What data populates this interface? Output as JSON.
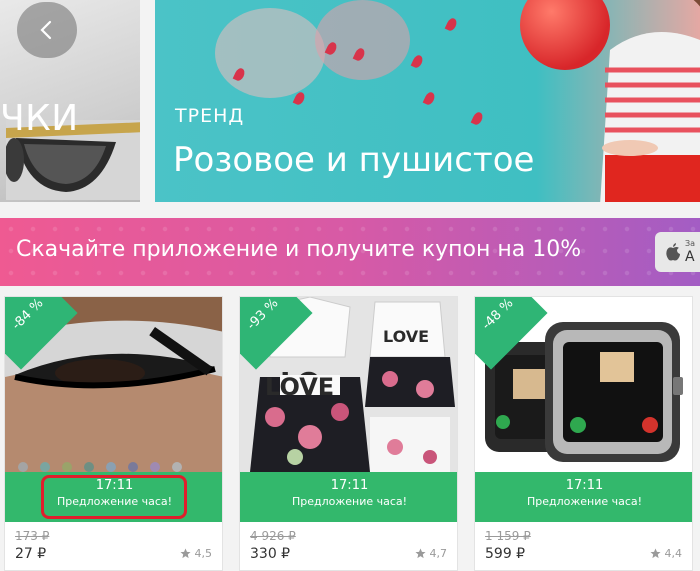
{
  "banners": {
    "left_label": "ЧКИ",
    "trend_small": "ТРЕНД",
    "trend_title": "Розовое и пушистое"
  },
  "promo": {
    "text": "Скачайте приложение и получите купон на 10%",
    "store_small": "За",
    "store_big": "A"
  },
  "icons": {
    "back": "chevron-left-icon",
    "star": "star-icon",
    "apple": "apple-icon"
  },
  "colors": {
    "deal_green": "#33b86c",
    "badge_green": "#2fb575",
    "highlight_red": "#e01e2c",
    "promo_pink": "#ef5a92",
    "promo_purple": "#a35dc4",
    "banner_teal": "#4bc3c7"
  },
  "products": [
    {
      "discount": "-84 %",
      "time": "17:11",
      "deal_label": "Предложение часа!",
      "old_price": "173 ₽",
      "price": "27 ₽",
      "rating": "4,5",
      "highlighted": true
    },
    {
      "discount": "-93 %",
      "time": "17:11",
      "deal_label": "Предложение часа!",
      "old_price": "4 926 ₽",
      "price": "330 ₽",
      "rating": "4,7",
      "highlighted": false
    },
    {
      "discount": "-48 %",
      "time": "17:11",
      "deal_label": "Предложение часа!",
      "old_price": "1 159 ₽",
      "price": "599 ₽",
      "rating": "4,4",
      "highlighted": false
    }
  ]
}
